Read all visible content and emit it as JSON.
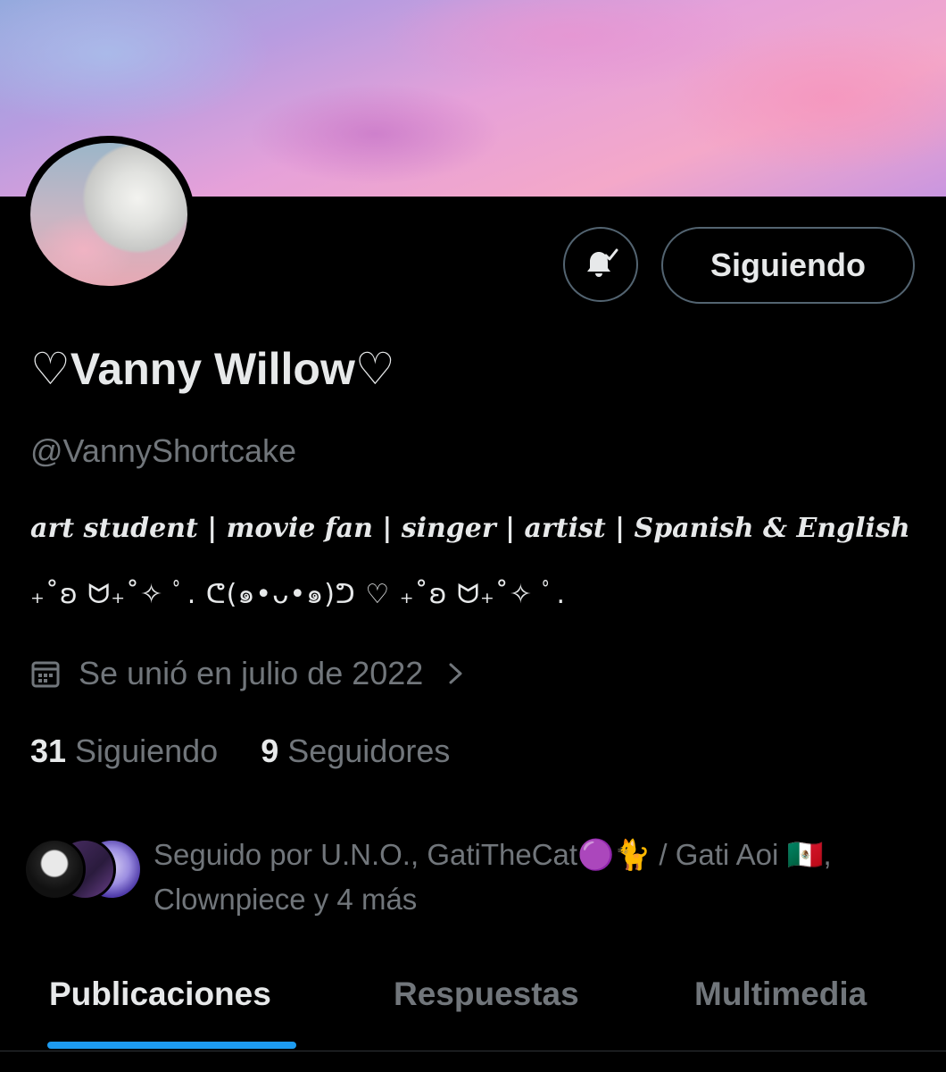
{
  "profile": {
    "display_name": "♡Vanny Willow♡",
    "handle": "@VannyShortcake",
    "bio_line1": "art student | movie fan | singer | artist | Spanish & English",
    "bio_line2": "₊˚ʚ ᗢ₊˚✧ ﾟ. ᕦ(๑•ᴗ•๑)ᕤ ♡ ₊˚ʚ ᗢ₊˚✧ ﾟ.",
    "joined": "Se unió en julio de 2022"
  },
  "actions": {
    "notify_icon": "bell-check-icon",
    "follow_label": "Siguiendo"
  },
  "stats": {
    "following_count": "31",
    "following_label": "Siguiendo",
    "followers_count": "9",
    "followers_label": "Seguidores"
  },
  "followed_by": {
    "text": "Seguido por U.N.O., GatiTheCat🟣🐈 / Gati Aoi 🇲🇽, Clownpiece y 4 más"
  },
  "tabs": [
    {
      "label": "Publicaciones",
      "active": true
    },
    {
      "label": "Respuestas",
      "active": false
    },
    {
      "label": "Multimedia",
      "active": false
    }
  ],
  "colors": {
    "background": "#000000",
    "text_primary": "#e7e9ea",
    "text_secondary": "#71767b",
    "border": "#536471",
    "accent": "#1d9bf0"
  }
}
